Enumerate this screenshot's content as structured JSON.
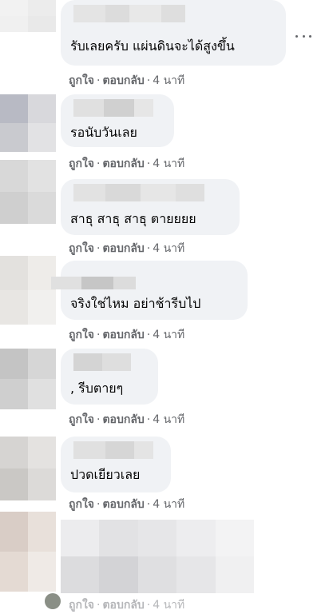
{
  "comments": [
    {
      "text": "รับเลยครับ แผ่นดินจะได้สูงขึ้น",
      "like": "ถูกใจ",
      "reply": "ตอบกลับ",
      "time": "4 นาที"
    },
    {
      "text": "รอนับวันเลย",
      "like": "ถูกใจ",
      "reply": "ตอบกลับ",
      "time": "4 นาที"
    },
    {
      "text": "สาธุ สาธุ สาธุ ตายยยย",
      "like": "ถูกใจ",
      "reply": "ตอบกลับ",
      "time": "4 นาที"
    },
    {
      "text": "จริงใช่ไหม อย่าช้ารีบไป",
      "like": "ถูกใจ",
      "reply": "ตอบกลับ",
      "time": "4 นาที"
    },
    {
      "text": ",  รีบตายๆ",
      "like": "ถูกใจ",
      "reply": "ตอบกลับ",
      "time": "4 นาที"
    },
    {
      "text": "ปวดเยียวเลย",
      "like": "ถูกใจ",
      "reply": "ตอบกลับ",
      "time": "4 นาที"
    },
    {
      "text": "",
      "like": "ถูกใจ",
      "reply": "ตอบกลับ",
      "time": "4 นาที"
    }
  ],
  "separator": "·",
  "icons": {
    "more": "more-horizontal-icon"
  }
}
